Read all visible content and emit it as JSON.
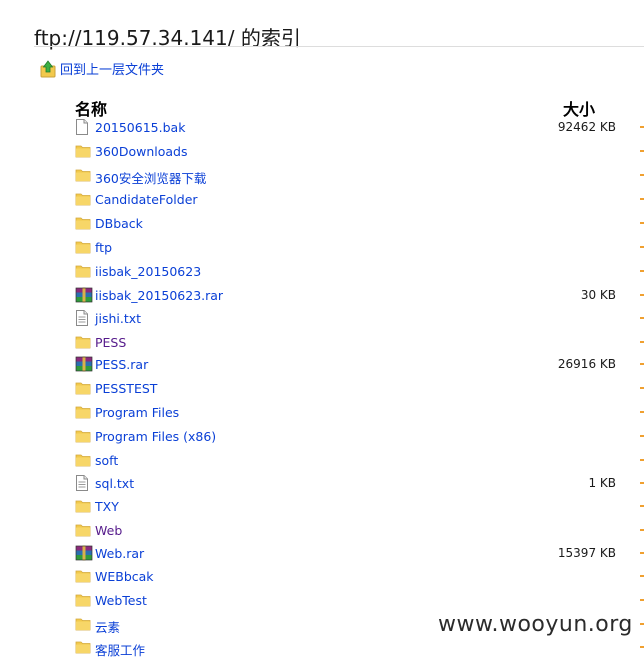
{
  "page": {
    "title": "ftp://119.57.34.141/ 的索引",
    "up_link_label": "回到上一层文件夹",
    "watermark": "www.wooyun.org"
  },
  "columns": {
    "name": "名称",
    "size": "大小"
  },
  "colors": {
    "link": "#0a3fd6",
    "visited_link": "#551a8b",
    "folder": "#f2c94c",
    "edge_mark": "#f0a030"
  },
  "files": [
    {
      "name": "20150615.bak",
      "type": "file",
      "size": "92462 KB",
      "visited": false
    },
    {
      "name": "360Downloads",
      "type": "folder",
      "size": "",
      "visited": false
    },
    {
      "name": "360安全浏览器下载",
      "type": "folder",
      "size": "",
      "visited": false
    },
    {
      "name": "CandidateFolder",
      "type": "folder",
      "size": "",
      "visited": false
    },
    {
      "name": "DBback",
      "type": "folder",
      "size": "",
      "visited": false
    },
    {
      "name": "ftp",
      "type": "folder",
      "size": "",
      "visited": false
    },
    {
      "name": "iisbak_20150623",
      "type": "folder",
      "size": "",
      "visited": false
    },
    {
      "name": "iisbak_20150623.rar",
      "type": "archive",
      "size": "30 KB",
      "visited": false
    },
    {
      "name": "jishi.txt",
      "type": "text",
      "size": "",
      "visited": false
    },
    {
      "name": "PESS",
      "type": "folder",
      "size": "",
      "visited": true
    },
    {
      "name": "PESS.rar",
      "type": "archive",
      "size": "26916 KB",
      "visited": false
    },
    {
      "name": "PESSTEST",
      "type": "folder",
      "size": "",
      "visited": false
    },
    {
      "name": "Program Files",
      "type": "folder",
      "size": "",
      "visited": false
    },
    {
      "name": "Program Files (x86)",
      "type": "folder",
      "size": "",
      "visited": false
    },
    {
      "name": "soft",
      "type": "folder",
      "size": "",
      "visited": false
    },
    {
      "name": "sql.txt",
      "type": "text",
      "size": "1 KB",
      "visited": false
    },
    {
      "name": "TXY",
      "type": "folder",
      "size": "",
      "visited": false
    },
    {
      "name": "Web",
      "type": "folder",
      "size": "",
      "visited": true
    },
    {
      "name": "Web.rar",
      "type": "archive",
      "size": "15397 KB",
      "visited": false
    },
    {
      "name": "WEBbcak",
      "type": "folder",
      "size": "",
      "visited": false
    },
    {
      "name": "WebTest",
      "type": "folder",
      "size": "",
      "visited": false
    },
    {
      "name": "云素",
      "type": "folder",
      "size": "",
      "visited": false
    },
    {
      "name": "客服工作",
      "type": "folder",
      "size": "",
      "visited": false
    }
  ]
}
